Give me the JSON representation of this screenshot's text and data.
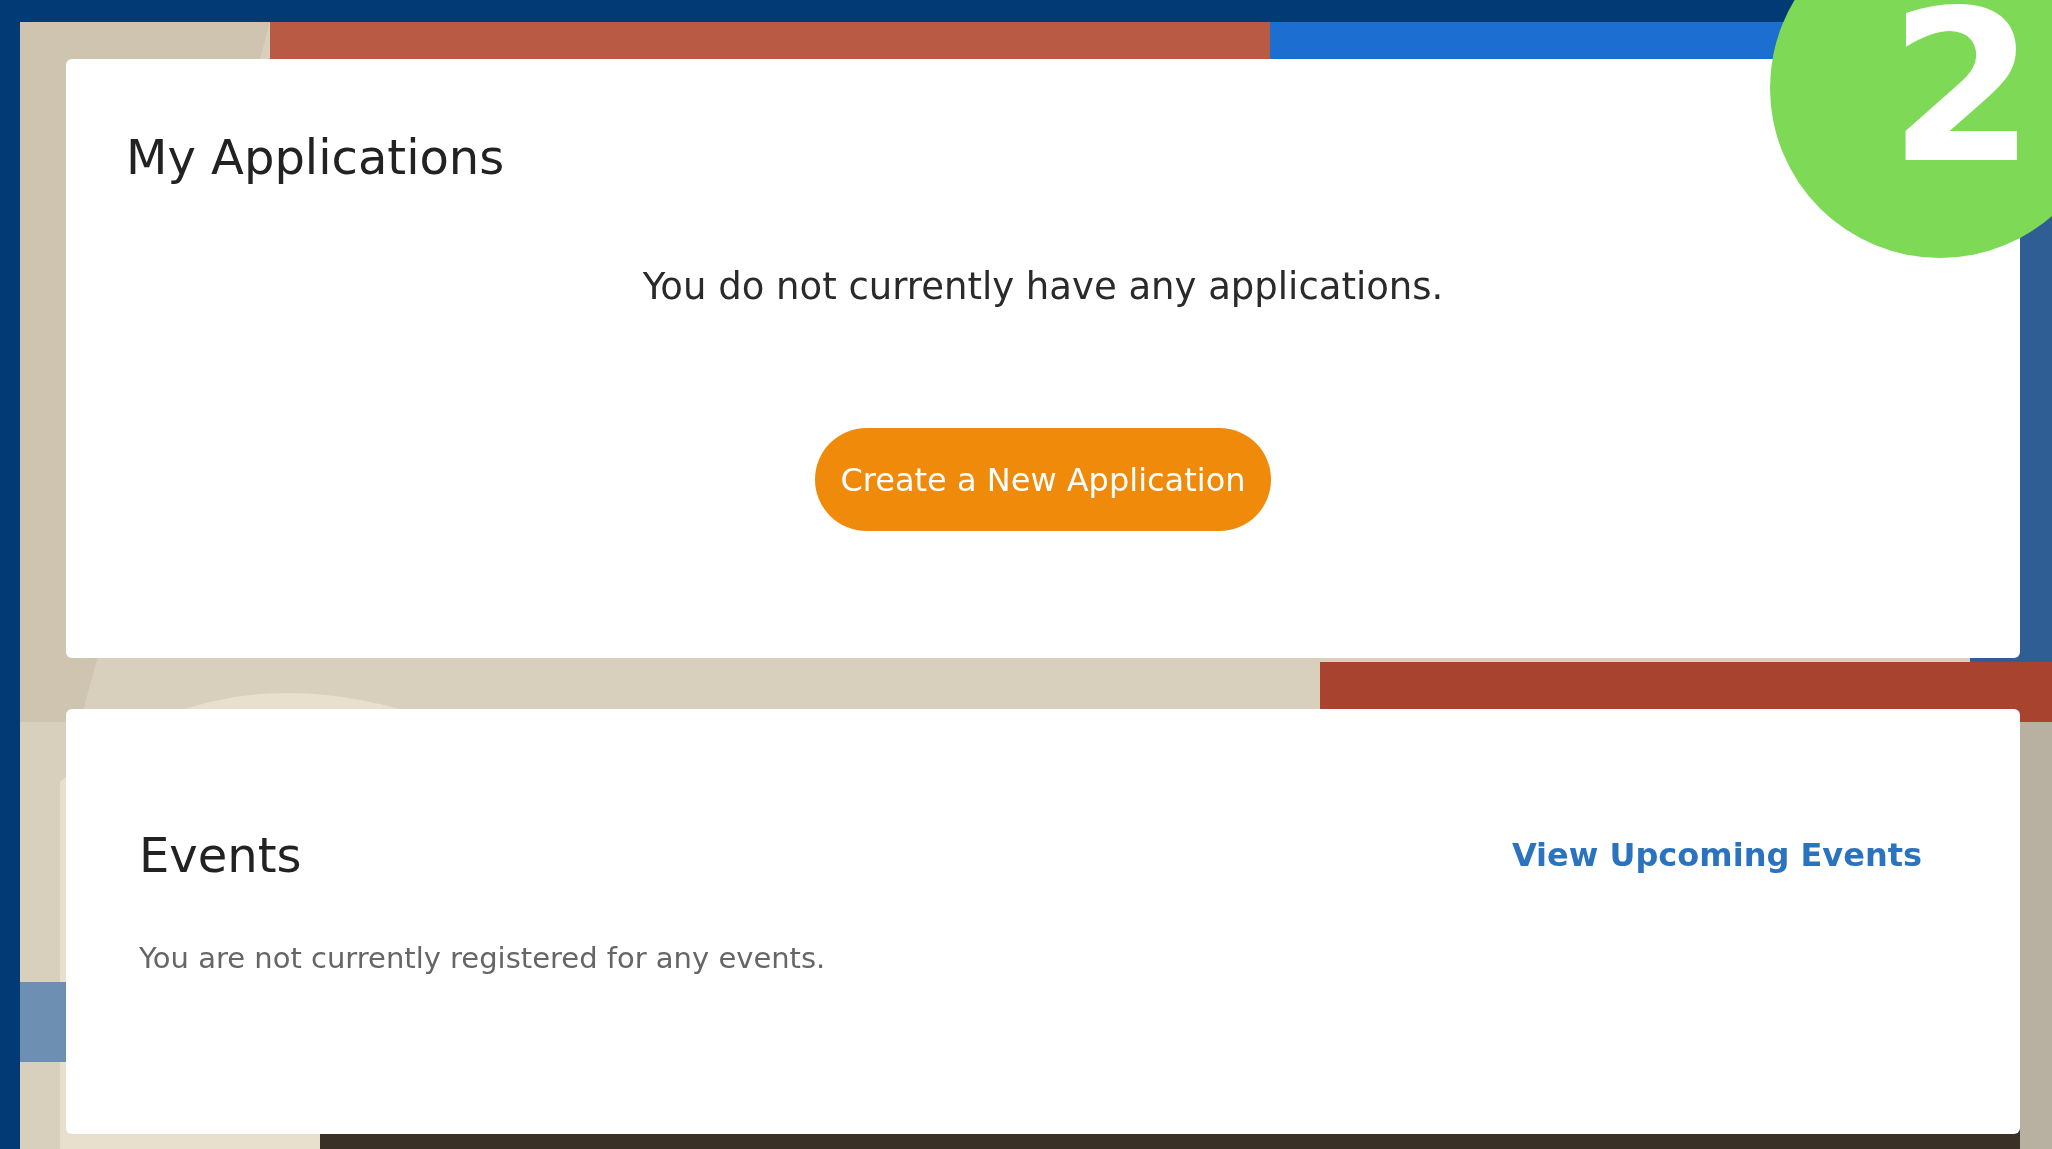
{
  "applications": {
    "title": "My Applications",
    "message": "You do not currently have any applications.",
    "button": "Create a New Application"
  },
  "events": {
    "title": "Events",
    "link": "View Upcoming Events",
    "message": "You are not currently registered for any events."
  },
  "step_badge": {
    "text": "2"
  }
}
